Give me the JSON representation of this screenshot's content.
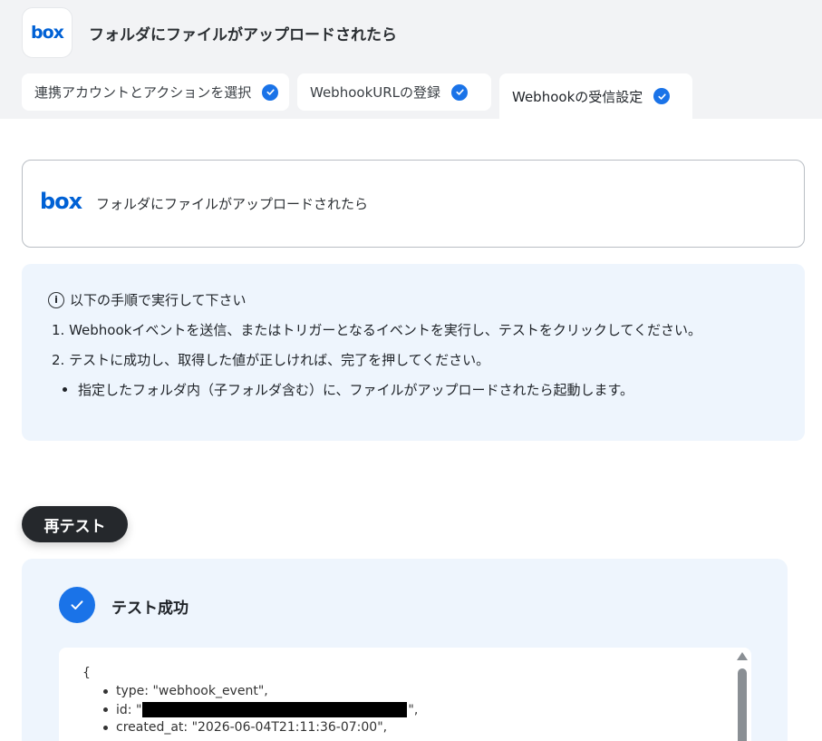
{
  "header": {
    "logo": "box",
    "title": "フォルダにファイルがアップロードされたら"
  },
  "tabs": [
    {
      "label": "連携アカウントとアクションを選択",
      "completed": true
    },
    {
      "label": "WebhookURLの登録",
      "completed": true
    },
    {
      "label": "Webhookの受信設定",
      "completed": true,
      "active": true
    }
  ],
  "trigger": {
    "logo": "box",
    "label": "フォルダにファイルがアップロードされたら"
  },
  "instructions": {
    "heading": "以下の手順で実行して下さい",
    "steps": [
      "1. Webhookイベントを送信、またはトリガーとなるイベントを実行し、テストをクリックしてください。",
      "2. テストに成功し、取得した値が正しければ、完了を押してください。"
    ],
    "note": "指定したフォルダ内（子フォルダ含む）に、ファイルがアップロードされたら起動します。"
  },
  "retest_button": "再テスト",
  "result": {
    "title": "テスト成功",
    "json": {
      "open_brace": "{",
      "lines": [
        {
          "text": "type: \"webhook_event\","
        },
        {
          "prefix": "id: \"",
          "suffix": "\","
        },
        {
          "text": "created_at: \"2026-06-04T21:11:36-07:00\","
        }
      ]
    }
  },
  "colors": {
    "accent": "#1a73e8",
    "box_brand": "#0061d5",
    "panel_bg": "#eef5fd",
    "topbar_bg": "#f2f3f5"
  }
}
